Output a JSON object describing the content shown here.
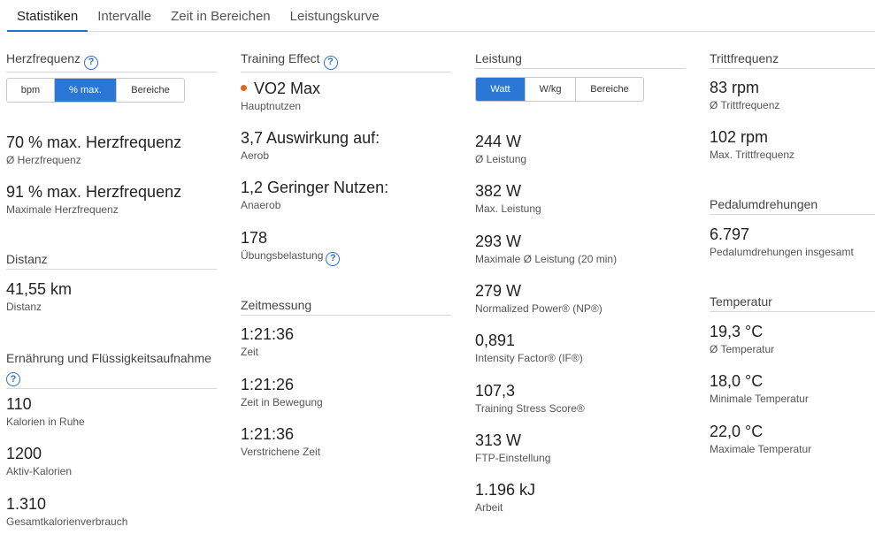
{
  "tabs": [
    "Statistiken",
    "Intervalle",
    "Zeit in Bereichen",
    "Leistungskurve"
  ],
  "herzfrequenz": {
    "title": "Herzfrequenz",
    "toggle": [
      "bpm",
      "% max.",
      "Bereiche"
    ],
    "selected": "% max.",
    "metrics": [
      {
        "value": "70 % max. Herzfrequenz",
        "label": "Ø Herzfrequenz"
      },
      {
        "value": "91 % max. Herzfrequenz",
        "label": "Maximale Herzfrequenz"
      }
    ]
  },
  "distanz": {
    "title": "Distanz",
    "metrics": [
      {
        "value": "41,55 km",
        "label": "Distanz"
      }
    ]
  },
  "ernaehrung": {
    "title": "Ernährung und Flüssigkeitsaufnahme",
    "metrics": [
      {
        "value": "110",
        "label": "Kalorien in Ruhe"
      },
      {
        "value": "1200",
        "label": "Aktiv-Kalorien"
      },
      {
        "value": "1.310",
        "label": "Gesamtkalorienverbrauch"
      }
    ]
  },
  "training_effect": {
    "title": "Training Effect",
    "dot_color": "#e0661f",
    "metrics": [
      {
        "value": "VO2 Max",
        "label": "Hauptnutzen"
      },
      {
        "value": "3,7 Auswirkung auf:",
        "label": "Aerob"
      },
      {
        "value": "1,2 Geringer Nutzen:",
        "label": "Anaerob"
      },
      {
        "value": "178",
        "label": "Übungsbelastung"
      }
    ]
  },
  "zeitmessung": {
    "title": "Zeitmessung",
    "metrics": [
      {
        "value": "1:21:36",
        "label": "Zeit"
      },
      {
        "value": "1:21:26",
        "label": "Zeit in Bewegung"
      },
      {
        "value": "1:21:36",
        "label": "Verstrichene Zeit"
      }
    ]
  },
  "leistung": {
    "title": "Leistung",
    "toggle": [
      "Watt",
      "W/kg",
      "Bereiche"
    ],
    "selected": "Watt",
    "metrics": [
      {
        "value": "244 W",
        "label": "Ø Leistung"
      },
      {
        "value": "382 W",
        "label": "Max. Leistung"
      },
      {
        "value": "293 W",
        "label": "Maximale Ø Leistung (20 min)"
      },
      {
        "value": "279 W",
        "label": "Normalized Power® (NP®)"
      },
      {
        "value": "0,891",
        "label": "Intensity Factor® (IF®)"
      },
      {
        "value": "107,3",
        "label": "Training Stress Score®"
      },
      {
        "value": "313 W",
        "label": "FTP-Einstellung"
      },
      {
        "value": "1.196 kJ",
        "label": "Arbeit"
      }
    ]
  },
  "trittfrequenz": {
    "title": "Trittfrequenz",
    "metrics": [
      {
        "value": "83 rpm",
        "label": "Ø Trittfrequenz"
      },
      {
        "value": "102 rpm",
        "label": "Max. Trittfrequenz"
      }
    ]
  },
  "pedal": {
    "title": "Pedalumdrehungen",
    "metrics": [
      {
        "value": "6.797",
        "label": "Pedalumdrehungen insgesamt"
      }
    ]
  },
  "temperatur": {
    "title": "Temperatur",
    "metrics": [
      {
        "value": "19,3 °C",
        "label": "Ø Temperatur"
      },
      {
        "value": "18,0 °C",
        "label": "Minimale Temperatur"
      },
      {
        "value": "22,0 °C",
        "label": "Maximale Temperatur"
      }
    ]
  },
  "icons": {
    "help": "question-circle-icon",
    "help_glyph": "?"
  }
}
